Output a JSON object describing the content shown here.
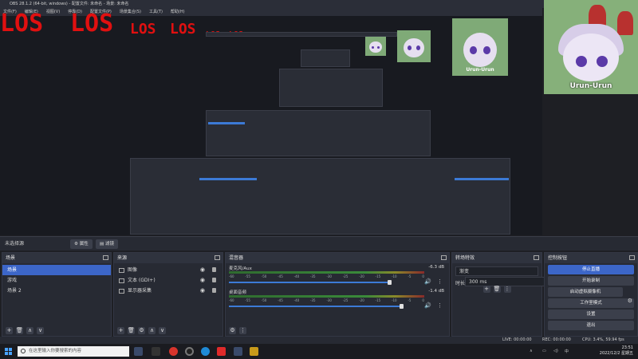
{
  "window": {
    "title": "OBS 28.1.2 (64-bit, windows) - 配置文件: 未命名 - 场景: 未命名"
  },
  "menu": [
    "文件(F)",
    "编辑(E)",
    "视图(V)",
    "停靠(D)",
    "配置文件(P)",
    "场景集合(S)",
    "工具(T)",
    "帮助(H)"
  ],
  "overlay": {
    "los": "LOS"
  },
  "avatar_caption": "Urun-Urun",
  "context": {
    "no_source": "未选择源",
    "properties": "属性",
    "filters": "滤镜"
  },
  "scenes": {
    "title": "场景",
    "items": [
      {
        "label": "场景",
        "selected": true
      },
      {
        "label": "游戏",
        "selected": false
      },
      {
        "label": "场景 2",
        "selected": false
      }
    ]
  },
  "sources": {
    "title": "来源",
    "items": [
      {
        "label": "图像",
        "icon": "image-icon"
      },
      {
        "label": "文本 (GDI+)",
        "icon": "text-icon"
      },
      {
        "label": "显示器采集",
        "icon": "monitor-icon"
      }
    ]
  },
  "mixer": {
    "title": "混音器",
    "tracks": [
      {
        "name": "麦克风/Aux",
        "db": "-6.3 dB",
        "level": 0.82
      },
      {
        "name": "桌面音频",
        "db": "-1.4 dB",
        "level": 0.88
      }
    ],
    "ticks": [
      "-60",
      "-55",
      "-50",
      "-45",
      "-40",
      "-35",
      "-30",
      "-25",
      "-20",
      "-15",
      "-10",
      "-5",
      "0"
    ]
  },
  "transitions": {
    "title": "转场特效",
    "type": "渐变",
    "duration_label": "时长",
    "duration": "300 ms"
  },
  "controls": {
    "title": "控制按钮",
    "buttons": [
      "停止直播",
      "开始录制",
      "启动虚拟摄像机",
      "工作室模式",
      "设置",
      "退出"
    ]
  },
  "status": {
    "live": "LIVE: 00:00:00",
    "rec": "REC: 00:00:00",
    "cpu": "CPU: 3.4%, 59.94 fps"
  },
  "taskbar": {
    "search_placeholder": "在这里输入你要搜索的内容",
    "time": "23:51",
    "date": "2022/12/2 星期五"
  },
  "colors": {
    "accent": "#3c66c8",
    "los_red": "#e01010"
  }
}
